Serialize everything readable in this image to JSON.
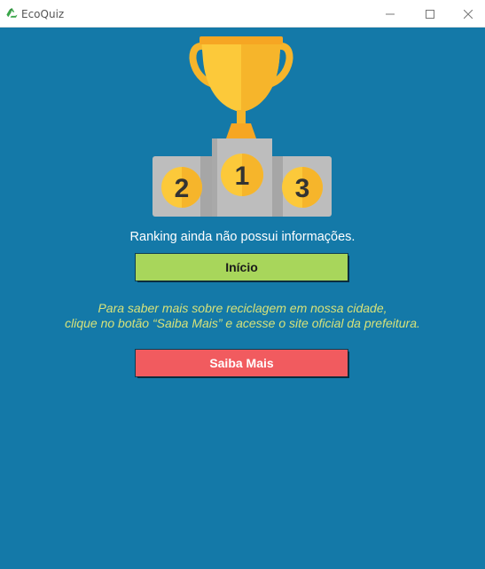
{
  "window": {
    "title": "EcoQuiz",
    "minimize_icon": "minimize-icon",
    "maximize_icon": "maximize-icon",
    "close_icon": "close-icon",
    "app_icon": "recycle-icon"
  },
  "podium": {
    "positions": [
      "2",
      "1",
      "3"
    ],
    "icon": "trophy-icon"
  },
  "main": {
    "message": "Ranking ainda não possui informações.",
    "start_button": "Início",
    "info_line1": "Para saber mais sobre reciclagem em nossa cidade,",
    "info_line2": "clique no botão “Saiba Mais” e acesse o site oficial da prefeitura.",
    "more_button": "Saiba Mais"
  },
  "colors": {
    "background": "#1479a8",
    "start_button": "#a8d65b",
    "more_button": "#f15b5f",
    "info_text": "#d6e27a",
    "gold": "#fcc93a"
  }
}
